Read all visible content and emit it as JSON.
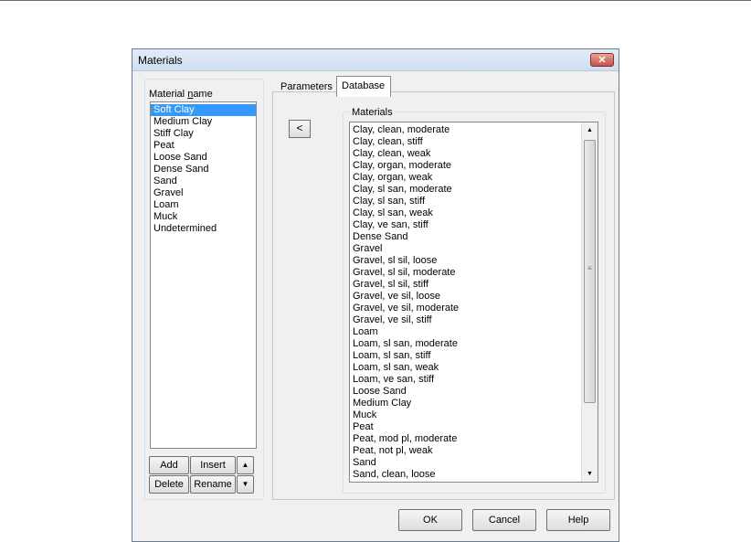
{
  "window": {
    "title": "Materials",
    "close_glyph": "✕"
  },
  "material_group": {
    "label_prefix": "Material ",
    "label_accel": "n",
    "label_suffix": "ame",
    "items": [
      "Soft Clay",
      "Medium Clay",
      "Stiff Clay",
      "Peat",
      "Loose Sand",
      "Dense Sand",
      "Sand",
      "Gravel",
      "Loam",
      "Muck",
      "Undetermined"
    ],
    "selected_index": 0
  },
  "buttons": {
    "add": "Add",
    "insert": "Insert",
    "delete": "Delete",
    "rename": "Rename",
    "move_up": "▲",
    "move_down": "▼"
  },
  "tabs": [
    {
      "label": "Parameters",
      "active": false
    },
    {
      "label": "Database",
      "active": true
    }
  ],
  "database": {
    "back_button": "<",
    "group_label": "Materials",
    "items": [
      "Clay, clean, moderate",
      "Clay, clean, stiff",
      "Clay, clean, weak",
      "Clay, organ, moderate",
      "Clay, organ, weak",
      "Clay, sl san, moderate",
      "Clay, sl san, stiff",
      "Clay, sl san, weak",
      "Clay, ve san, stiff",
      "Dense Sand",
      "Gravel",
      "Gravel, sl sil, loose",
      "Gravel, sl sil, moderate",
      "Gravel, sl sil, stiff",
      "Gravel, ve sil, loose",
      "Gravel, ve sil, moderate",
      "Gravel, ve sil, stiff",
      "Loam",
      "Loam, sl san, moderate",
      "Loam, sl san, stiff",
      "Loam, sl san, weak",
      "Loam, ve san, stiff",
      "Loose Sand",
      "Medium Clay",
      "Muck",
      "Peat",
      "Peat, mod pl, moderate",
      "Peat, not pl, weak",
      "Sand",
      "Sand, clean, loose"
    ],
    "scroll_up": "▲",
    "scroll_down": "▼",
    "scroll_grip": "≡"
  },
  "footer": {
    "ok": "OK",
    "cancel": "Cancel",
    "help": "Help"
  }
}
